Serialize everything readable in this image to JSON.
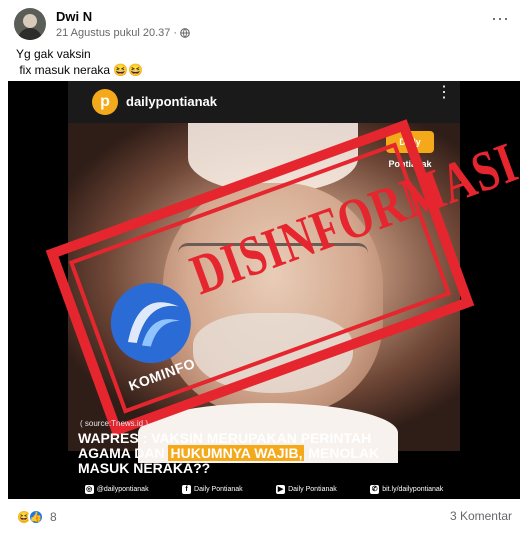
{
  "post": {
    "author": "Dwi N",
    "timestamp": "21 Agustus pukul 20.37",
    "dot_separator": "·",
    "more_icon": "⋯",
    "caption_lines": [
      "Yg gak vaksin",
      " fix masuk neraka 😆😆"
    ]
  },
  "image": {
    "ig_logo_letter": "p",
    "ig_account": "dailypontianak",
    "ig_more": "⋮",
    "badge_text": "Daily Pontianak",
    "stamp_text": "DISINFORMASI",
    "kominfo_label": "KOMINFO",
    "source_note": "( source:Tnews.id )",
    "headline_line1": "WAPRES : VAKSIN MERUPAKAN PERINTAH",
    "headline_line2_a": "AGAMA DAN ",
    "headline_line2_highlight": "HUKUMNYA WAJIB,",
    "headline_line2_b": " MENOLAK",
    "headline_line3": "MASUK NERAKA??",
    "footer": [
      {
        "icon": "instagram-icon",
        "glyph": "◎",
        "label": "@dailypontianak"
      },
      {
        "icon": "facebook-icon",
        "glyph": "f",
        "label": "Daily Pontianak"
      },
      {
        "icon": "youtube-icon",
        "glyph": "▶",
        "label": "Daily Pontianak"
      },
      {
        "icon": "whatsapp-icon",
        "glyph": "✆",
        "label": "bit.ly/dailypontianak"
      }
    ]
  },
  "reactions": {
    "emoji1": "😆",
    "emoji2": "👍",
    "count": "8",
    "comments": "3 Komentar"
  },
  "colors": {
    "stamp_red": "#e5262e",
    "accent_orange": "#f4a91b",
    "kominfo_blue": "#2a6bd6"
  }
}
